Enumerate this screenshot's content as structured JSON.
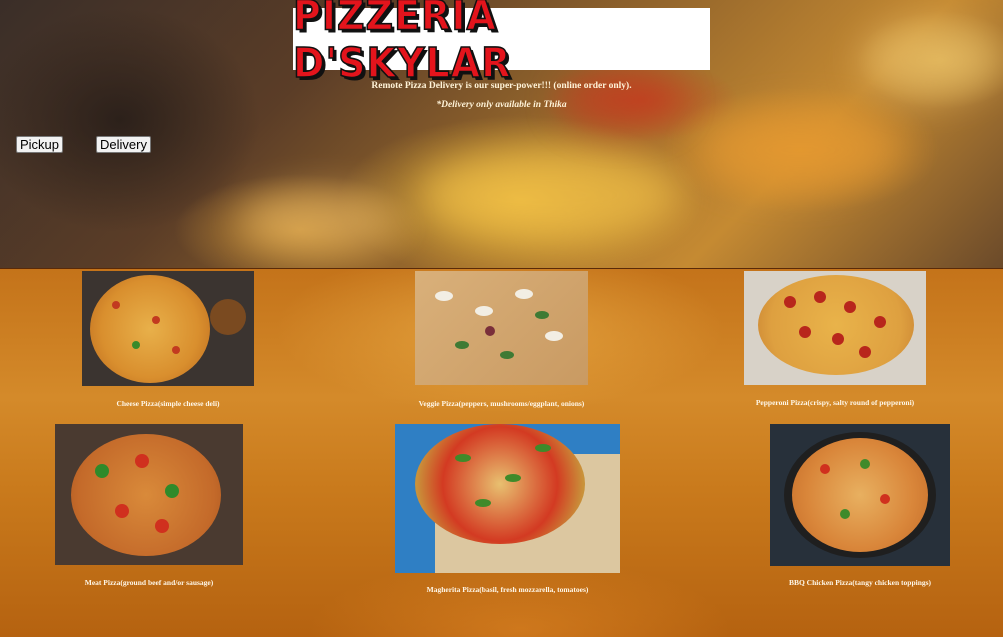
{
  "header": {
    "logo_text": "PIZZERIA D'SKYLAR",
    "tagline": "Remote Pizza Delivery is our super-power!!! (online order only).",
    "delivery_note": "*Delivery only available in Thika"
  },
  "order_buttons": {
    "pickup": "Pickup",
    "delivery": "Delivery"
  },
  "menu": {
    "items": [
      {
        "caption": "Cheese Pizza(simple cheese deli)"
      },
      {
        "caption": "Veggie Pizza(peppers, mushrooms/eggplant, onions)"
      },
      {
        "caption": "Pepperoni Pizza(crispy, salty round of pepperoni)"
      },
      {
        "caption": "Meat Pizza(ground beef and/or sausage)"
      },
      {
        "caption": "Magherita Pizza(basil, fresh mozzarella, tomatoes)"
      },
      {
        "caption": "BBQ Chicken Pizza(tangy chicken toppings)"
      }
    ]
  },
  "colors": {
    "logo_red": "#e3141c",
    "caption_text": "#fff7e8",
    "menu_background": "#c97a1c"
  }
}
